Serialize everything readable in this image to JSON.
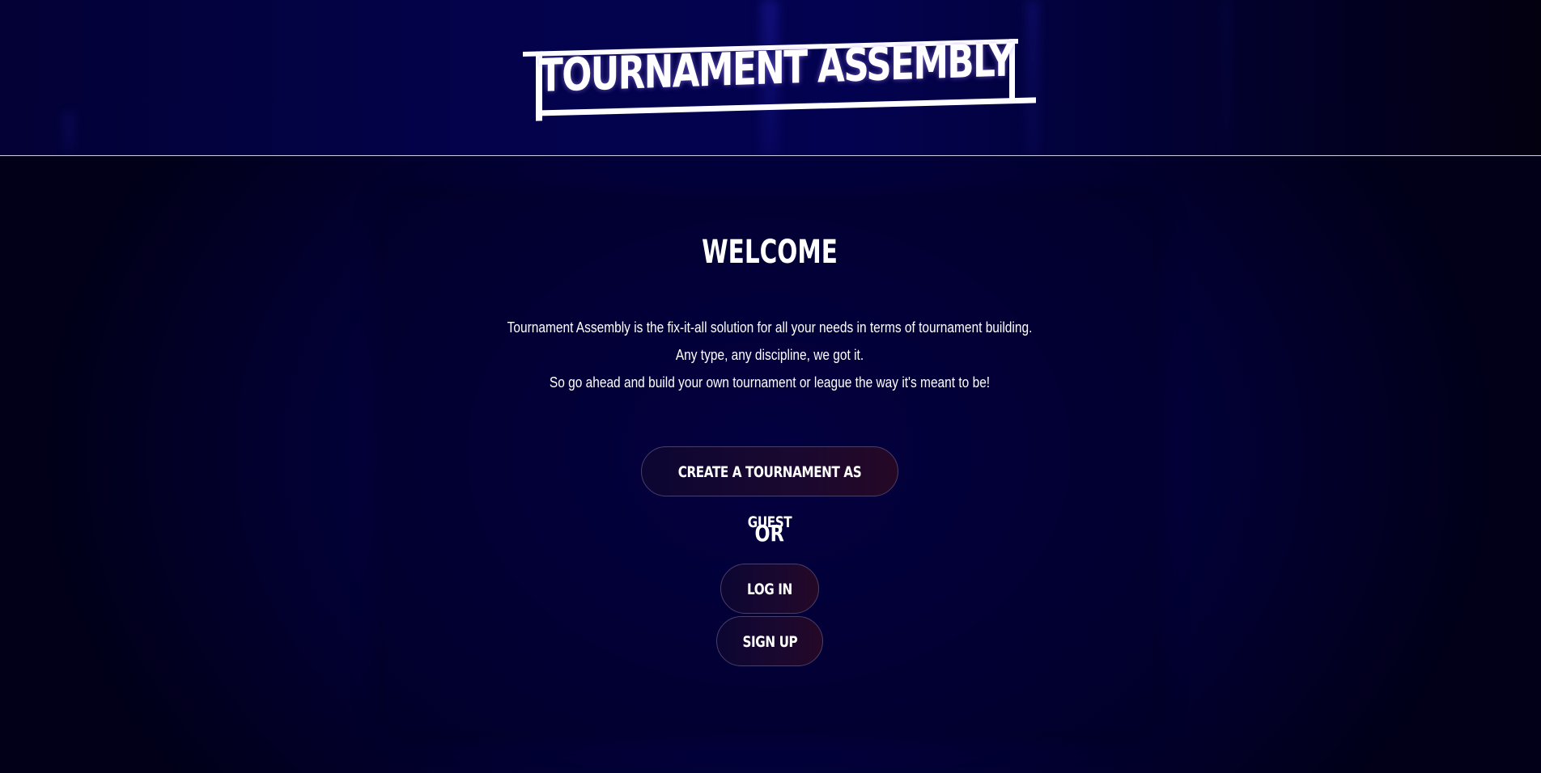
{
  "header": {
    "logo_text": "TOURNAMENT ASSEMBLY"
  },
  "main": {
    "title": "WELCOME",
    "description": [
      "Tournament Assembly is the fix-it-all solution for all your needs in terms of tournament building.",
      "Any type, any discipline, we got it.",
      "So go ahead and build your own tournament or league the way it's meant to be!"
    ],
    "guest_button": "CREATE A TOURNAMENT AS GUEST",
    "or_label": "OR",
    "login_button": "LOG IN",
    "signup_button": "SIGN UP"
  },
  "colors": {
    "background": "#020018",
    "header_background": "#03024a",
    "button_border": "#4a3f66",
    "text": "#ffffff"
  }
}
